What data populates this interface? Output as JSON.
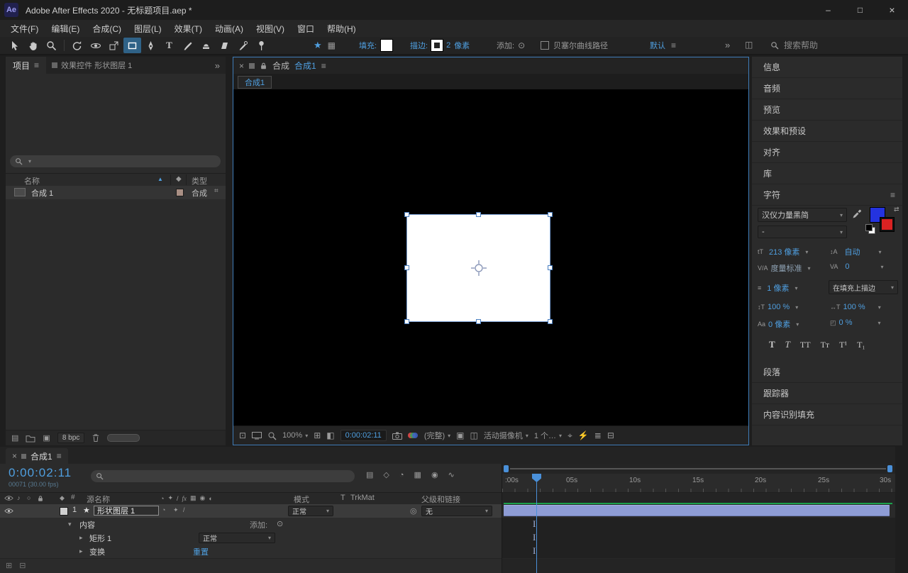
{
  "titlebar": {
    "app_icon": "Ae",
    "title": "Adobe After Effects 2020 - 无标题项目.aep *",
    "minimize": "–",
    "maximize": "□",
    "close": "×"
  },
  "menubar": {
    "items": [
      "文件(F)",
      "编辑(E)",
      "合成(C)",
      "图层(L)",
      "效果(T)",
      "动画(A)",
      "视图(V)",
      "窗口",
      "帮助(H)"
    ]
  },
  "toolbar": {
    "fill_label": "填充:",
    "fill_color": "#ffffff",
    "stroke_label": "描边:",
    "stroke_width": "2",
    "stroke_unit": "像素",
    "add_label": "添加:",
    "bezier_label": "贝塞尔曲线路径",
    "workspace_label": "默认",
    "overflow": "»",
    "search_placeholder": "搜索帮助"
  },
  "project_panel": {
    "tab_project": "项目",
    "tab_effect_controls": "效果控件 形状图层 1",
    "overflow": "»",
    "col_name": "名称",
    "col_type": "类型",
    "item_name": "合成 1",
    "item_type": "合成",
    "item_label_color": "#a98f84",
    "depth_label": "8 bpc"
  },
  "comp_panel": {
    "close": "×",
    "panel_label": "合成",
    "comp_name": "合成1",
    "viewer_tab": "合成1",
    "zoom": "100%",
    "timecode": "0:00:02:11",
    "resolution": "(完整)",
    "camera": "活动摄像机",
    "views": "1 个…"
  },
  "right_panels": {
    "items": [
      "信息",
      "音频",
      "预览",
      "效果和预设",
      "对齐",
      "库",
      "字符",
      "段落",
      "跟踪器",
      "内容识别填充"
    ]
  },
  "character_panel": {
    "font_family": "汉仪力量黑简",
    "font_style": "-",
    "font_size": "213 像素",
    "leading": "自动",
    "kerning": "度量标准",
    "tracking": "0",
    "stroke_width": "1 像素",
    "stroke_style": "在填充上描边",
    "vertical_scale": "100 %",
    "horizontal_scale": "100 %",
    "baseline_shift": "0 像素",
    "tsume": "0 %",
    "fill_color": "#2433e0",
    "stroke_color": "#d92222",
    "styles": [
      "T",
      "T",
      "TT",
      "Tᴛ",
      "T¹",
      "T₁"
    ]
  },
  "timeline": {
    "tab_close": "×",
    "tab_name": "合成1",
    "timecode": "0:00:02:11",
    "frame_info": "00071 (30.00 fps)",
    "col_source_name": "源名称",
    "col_mode": "模式",
    "col_t": "T",
    "col_trkmat": "TrkMat",
    "col_parent": "父级和链接",
    "layer_number": "1",
    "layer_name": "形状图层 1",
    "layer_mode": "正常",
    "layer_parent": "无",
    "group_contents": "内容",
    "add_label": "添加:",
    "group_rect": "矩形 1",
    "rect_mode": "正常",
    "group_transform": "变换",
    "reset_label": "重置",
    "layer_bar_color": "#8e9cd5",
    "ruler_labels": [
      ":00s",
      "05s",
      "10s",
      "15s",
      "20s",
      "25s",
      "30s"
    ]
  }
}
